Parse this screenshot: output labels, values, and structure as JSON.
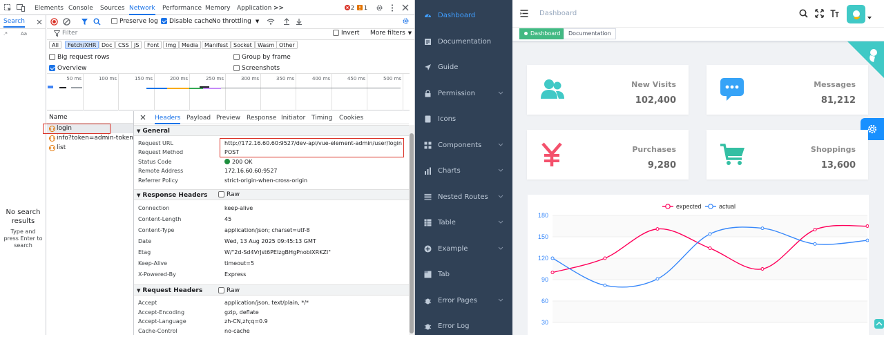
{
  "devtools": {
    "main_tabs": [
      "Elements",
      "Console",
      "Sources",
      "Network",
      "Performance",
      "Memory",
      "Application"
    ],
    "active_tab": "Network",
    "more_tabs": ">>",
    "error_count": "2",
    "warning_count": "1",
    "search_tab": "Search",
    "toolbar": {
      "preserve_log": "Preserve log",
      "disable_cache": "Disable cache",
      "throttling": "No throttling"
    },
    "filter": {
      "placeholder": "Filter",
      "invert": "Invert",
      "more_filters": "More filters"
    },
    "type_filters": [
      "All",
      "Fetch/XHR",
      "Doc",
      "CSS",
      "JS",
      "Font",
      "Img",
      "Media",
      "Manifest",
      "Socket",
      "Wasm",
      "Other"
    ],
    "active_type_filter": "Fetch/XHR",
    "options": {
      "big_request_rows": "Big request rows",
      "overview": "Overview",
      "group_by_frame": "Group by frame",
      "screenshots": "Screenshots"
    },
    "timeline_ticks": [
      "50 ms",
      "100 ms",
      "150 ms",
      "200 ms",
      "250 ms",
      "300 ms",
      "350 ms",
      "400 ms",
      "450 ms",
      "500 ms"
    ],
    "search_panel": {
      "case_label": "Aa",
      "no_results": "No search results",
      "hint": "Type and press Enter to search"
    },
    "name_header": "Name",
    "requests": [
      "login",
      "info?token=admin-token",
      "list"
    ],
    "selected_request": "login",
    "detail_tabs": [
      "Headers",
      "Payload",
      "Preview",
      "Response",
      "Initiator",
      "Timing",
      "Cookies"
    ],
    "active_detail_tab": "Headers",
    "general_title": "General",
    "general": [
      {
        "k": "Request URL",
        "v": "http://172.16.60.60:9527/dev-api/vue-element-admin/user/login"
      },
      {
        "k": "Request Method",
        "v": "POST"
      },
      {
        "k": "Status Code",
        "v": "200 OK"
      },
      {
        "k": "Remote Address",
        "v": "172.16.60.60:9527"
      },
      {
        "k": "Referrer Policy",
        "v": "strict-origin-when-cross-origin"
      }
    ],
    "response_headers_title": "Response Headers",
    "raw_label": "Raw",
    "response_headers": [
      {
        "k": "Connection",
        "v": "keep-alive"
      },
      {
        "k": "Content-Length",
        "v": "45"
      },
      {
        "k": "Content-Type",
        "v": "application/json; charset=utf-8"
      },
      {
        "k": "Date",
        "v": "Wed, 13 Aug 2025 09:45:13 GMT"
      },
      {
        "k": "Etag",
        "v": "W/\"2d-Sd4VrJst6PElzgBHgPnobIXRKZI\""
      },
      {
        "k": "Keep-Alive",
        "v": "timeout=5"
      },
      {
        "k": "X-Powered-By",
        "v": "Express"
      }
    ],
    "request_headers_title": "Request Headers",
    "request_headers": [
      {
        "k": "Accept",
        "v": "application/json, text/plain, */*"
      },
      {
        "k": "Accept-Encoding",
        "v": "gzip, deflate"
      },
      {
        "k": "Accept-Language",
        "v": "zh-CN,zh;q=0.9"
      },
      {
        "k": "Cache-Control",
        "v": "no-cache"
      }
    ],
    "colors": {
      "accent": "#1a73e8",
      "status_ok": "#1e8e3e",
      "highlight_box": "#d93025"
    }
  },
  "sidebar": {
    "items": [
      {
        "label": "Dashboard",
        "icon": "dashboard-icon",
        "active": true
      },
      {
        "label": "Documentation",
        "icon": "documentation-icon"
      },
      {
        "label": "Guide",
        "icon": "guide-icon"
      },
      {
        "label": "Permission",
        "icon": "lock-icon",
        "submenu": true
      },
      {
        "label": "Icons",
        "icon": "icons-icon"
      },
      {
        "label": "Components",
        "icon": "components-icon",
        "submenu": true
      },
      {
        "label": "Charts",
        "icon": "chart-icon",
        "submenu": true
      },
      {
        "label": "Nested Routes",
        "icon": "nested-icon",
        "submenu": true
      },
      {
        "label": "Table",
        "icon": "table-icon",
        "submenu": true
      },
      {
        "label": "Example",
        "icon": "example-icon",
        "submenu": true
      },
      {
        "label": "Tab",
        "icon": "tab-icon"
      },
      {
        "label": "Error Pages",
        "icon": "bug-icon",
        "submenu": true
      },
      {
        "label": "Error Log",
        "icon": "bug-icon"
      }
    ],
    "colors": {
      "background": "#304156",
      "text": "#bfcbd9",
      "active": "#409eff"
    }
  },
  "dashboard": {
    "breadcrumb": "Dashboard",
    "tags": [
      {
        "label": "Dashboard",
        "active": true
      },
      {
        "label": "Documentation"
      }
    ],
    "cards": [
      {
        "label": "New Visits",
        "value": "102,400",
        "icon": "peoples-icon",
        "color": "#40c9c6"
      },
      {
        "label": "Messages",
        "value": "81,212",
        "icon": "message-icon",
        "color": "#36a3f7"
      },
      {
        "label": "Purchases",
        "value": "9,280",
        "icon": "money-icon",
        "color": "#f4516c"
      },
      {
        "label": "Shoppings",
        "value": "13,600",
        "icon": "shopping-icon",
        "color": "#34bfa3"
      }
    ],
    "colors": {
      "tag_active": "#42b983",
      "settings_button": "#1890ff",
      "corner": "#40c9c6"
    }
  },
  "chart_data": {
    "type": "line",
    "title": "",
    "xlabel": "",
    "ylabel": "",
    "x": [
      1,
      2,
      3,
      4,
      5,
      6,
      7
    ],
    "series": [
      {
        "name": "expected",
        "color": "#ff005a",
        "values": [
          100,
          120,
          161,
          134,
          105,
          160,
          165
        ]
      },
      {
        "name": "actual",
        "color": "#3888fa",
        "values": [
          120,
          82,
          91,
          154,
          162,
          140,
          145
        ]
      }
    ],
    "ylim": [
      0,
      180
    ],
    "yticks": [
      "180",
      "150",
      "120",
      "90",
      "60",
      "30"
    ],
    "legend": "top-center",
    "grid": true
  }
}
